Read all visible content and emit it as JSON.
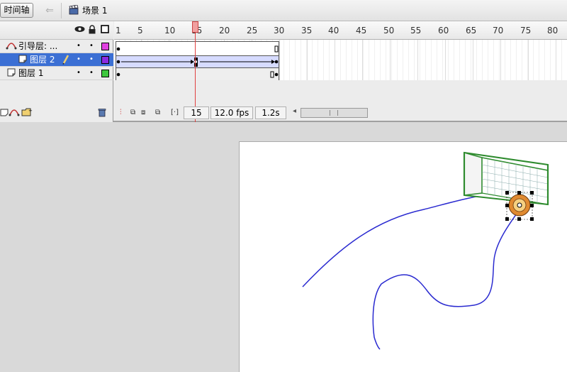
{
  "topbar": {
    "timeline_button": "时间轴",
    "scene_name": "场景 1"
  },
  "layers_header": {
    "eye_icon": "eye-icon",
    "lock_icon": "lock-icon",
    "outline_icon": "outline-square-icon"
  },
  "layers": [
    {
      "name": "引导层: ...",
      "type": "guide-layer-icon",
      "color": "#e040e0",
      "selected": false
    },
    {
      "name": "图层 2",
      "type": "layer-icon",
      "color": "#8a2be2",
      "selected": true
    },
    {
      "name": "图层 1",
      "type": "layer-icon",
      "color": "#3ec83e",
      "selected": false
    }
  ],
  "ruler": [
    "1",
    "5",
    "10",
    "15",
    "20",
    "25",
    "30",
    "35",
    "40",
    "45",
    "50",
    "55",
    "60",
    "65",
    "70",
    "75",
    "80"
  ],
  "status": {
    "current_frame": "15",
    "frame_rate": "12.0 fps",
    "elapsed": "1.2s"
  },
  "colors": {
    "selection": "#3b6fd4",
    "playhead": "#e04040",
    "motion_path": "#2a2ad0",
    "goal_net": "#2e8b2e"
  }
}
